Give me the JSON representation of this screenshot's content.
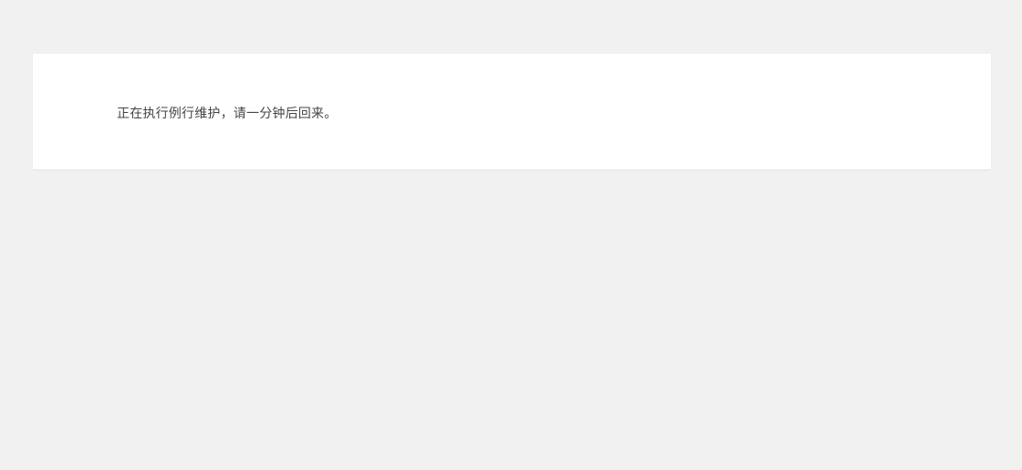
{
  "maintenance": {
    "message": "正在执行例行维护，请一分钟后回来。"
  }
}
